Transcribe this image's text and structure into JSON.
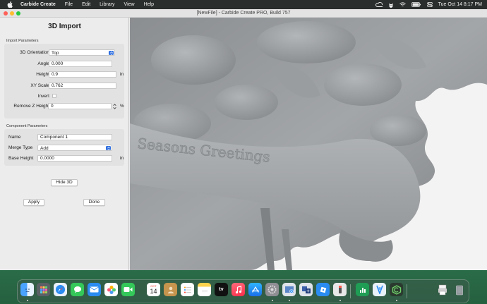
{
  "menubar": {
    "app_name": "Carbide Create",
    "items": [
      "File",
      "Edit",
      "Library",
      "View",
      "Help"
    ],
    "clock": "Tue Oct 14  8:17 PM",
    "status_icons": [
      "creative-cloud-icon",
      "cat-icon",
      "wifi-icon",
      "battery-icon",
      "control-center-icon"
    ]
  },
  "window": {
    "title": "[NewFile] - Carbide Create PRO, Build 757"
  },
  "panel": {
    "title": "3D Import",
    "import_section": {
      "label": "Import Parameters",
      "orientation": {
        "label": "3D Orientation",
        "value": "Top"
      },
      "angle": {
        "label": "Angle",
        "value": "0.000"
      },
      "height": {
        "label": "Height",
        "value": "0.9",
        "unit": "in"
      },
      "xy_scale": {
        "label": "XY Scale",
        "value": "0.762"
      },
      "invert": {
        "label": "Invert",
        "checked": false
      },
      "remove_z": {
        "label": "Remove Z Height",
        "value": "0",
        "unit": "%"
      }
    },
    "component_section": {
      "label": "Component Parameters",
      "name": {
        "label": "Name",
        "value": "Component 1"
      },
      "merge_type": {
        "label": "Merge Type",
        "value": "Add"
      },
      "base_height": {
        "label": "Base Height",
        "value": "0.0000",
        "unit": "in"
      }
    },
    "buttons": {
      "hide3d": "Hide 3D",
      "apply": "Apply",
      "done": "Done"
    }
  },
  "viewport": {
    "banner_text": "Seasons Greetings"
  },
  "dock": {
    "calendar_month": "OCT",
    "calendar_day": "14",
    "tv_label": "tv",
    "icons": [
      "finder-icon",
      "launchpad-icon",
      "safari-icon",
      "messages-icon",
      "mail-icon",
      "photos-icon",
      "facetime-icon",
      "calendar-icon",
      "contacts-icon",
      "reminders-icon",
      "notes-icon",
      "tv-icon",
      "music-icon",
      "app-store-icon",
      "system-settings-icon",
      "screenshot-icon",
      "add-window-icon",
      "roblox-icon",
      "stylus-icon",
      "numbers-icon",
      "xcode-icon",
      "carbide-create-icon",
      "printer-icon",
      "trash-icon"
    ]
  }
}
